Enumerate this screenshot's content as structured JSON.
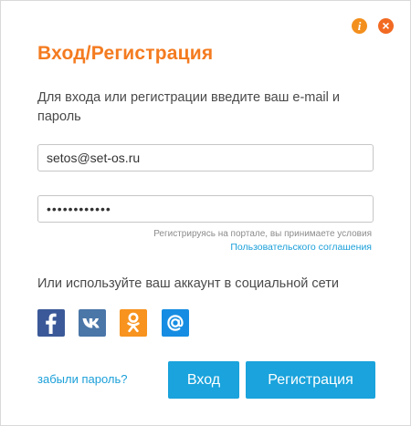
{
  "dialog": {
    "title": "Вход/Регистрация",
    "subtitle": "Для входа или регистрации введите ваш e-mail и пароль",
    "info_icon": "i",
    "close_icon": "×"
  },
  "form": {
    "email_value": "setos@set-os.ru",
    "password_value": "••••••••••••",
    "terms_text": "Регистрируясь на портале, вы принимаете условия",
    "terms_link": "Пользовательского соглашения"
  },
  "social": {
    "label": "Или используйте ваш аккаунт в социальной сети",
    "networks": [
      {
        "icon": "facebook-icon",
        "color": "#3b5998"
      },
      {
        "icon": "vk-icon",
        "color": "#4a76a8"
      },
      {
        "icon": "odnoklassniki-icon",
        "color": "#f7931e"
      },
      {
        "icon": "mailru-icon",
        "color": "#168de2"
      }
    ]
  },
  "actions": {
    "forgot_label": "забыли пароль?",
    "login_label": "Вход",
    "register_label": "Регистрация"
  },
  "colors": {
    "accent_orange": "#f47b20",
    "link_blue": "#1a9fd9",
    "button_blue": "#1aa3dc"
  }
}
